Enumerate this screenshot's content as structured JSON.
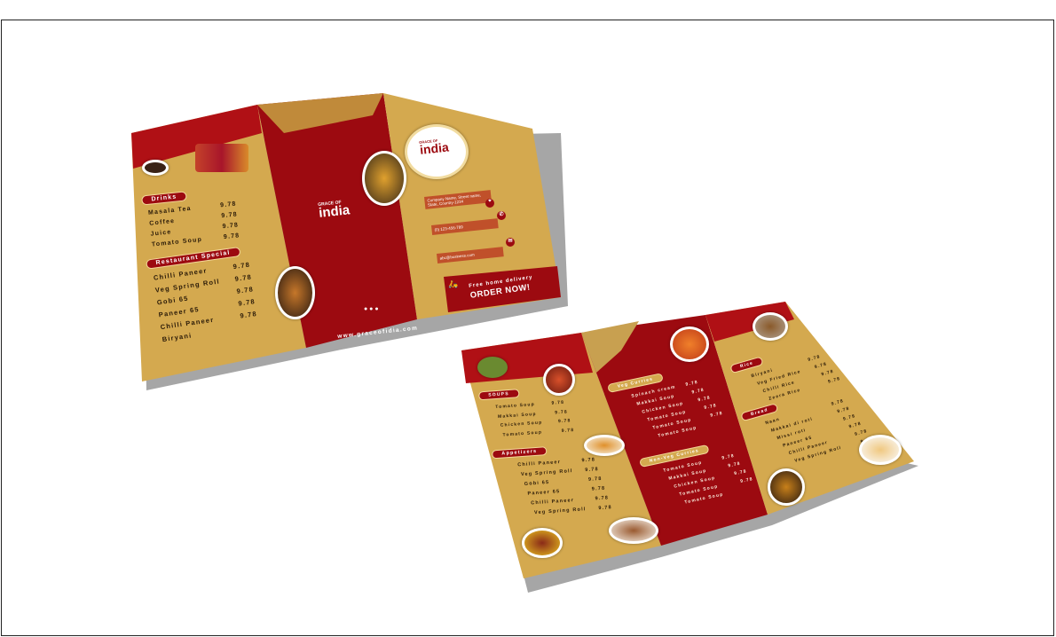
{
  "front": {
    "sections": [
      {
        "title": "Drinks",
        "items": [
          {
            "name": "Masala Tea",
            "price": "9.78"
          },
          {
            "name": "Coffee",
            "price": "9.78"
          },
          {
            "name": "Juice",
            "price": "9.78"
          },
          {
            "name": "Tomato Soup",
            "price": "9.78"
          }
        ]
      },
      {
        "title": "Restaurant Special",
        "items": [
          {
            "name": "Chilli Paneer",
            "price": "9.78"
          },
          {
            "name": "Veg Spring Roll",
            "price": "9.78"
          },
          {
            "name": "Gobi 65",
            "price": "9.78"
          },
          {
            "name": "Paneer 65",
            "price": "9.78"
          },
          {
            "name": "Chilli Paneer",
            "price": "9.78"
          },
          {
            "name": "Biryani",
            "price": ""
          }
        ]
      }
    ],
    "logo": {
      "small": "GRACE OF",
      "big": "india"
    },
    "website": "www.graceofidia.com",
    "contact": {
      "address": "Company Name, Street name, State, Country-1234",
      "phone": "(0) 123-456-789",
      "email": "abc@business.com"
    },
    "delivery": {
      "line1": "Free home delivery",
      "line2": "ORDER NOW!"
    }
  },
  "inside": {
    "soups": {
      "title": "SOUPS",
      "items": [
        {
          "name": "Tomato Soup",
          "price": "9.78"
        },
        {
          "name": "Makkai Soup",
          "price": "9.78"
        },
        {
          "name": "Chicken Soup",
          "price": "9.78"
        },
        {
          "name": "Tomato Soup",
          "price": "9.78"
        }
      ]
    },
    "appetizers": {
      "title": "Appetizers",
      "items": [
        {
          "name": "Chilli Paneer",
          "price": "9.78"
        },
        {
          "name": "Veg Spring Roll",
          "price": "9.78"
        },
        {
          "name": "Gobi 65",
          "price": "9.78"
        },
        {
          "name": "Paneer 65",
          "price": "9.78"
        },
        {
          "name": "Chilli Paneer",
          "price": "9.78"
        },
        {
          "name": "Veg Spring Roll",
          "price": "9.78"
        }
      ]
    },
    "veg": {
      "title": "Veg Curries",
      "items": [
        {
          "name": "Spinach cream",
          "price": "9.78"
        },
        {
          "name": "Makkai Soup",
          "price": "9.78"
        },
        {
          "name": "Chicken Soup",
          "price": "9.78"
        },
        {
          "name": "Tomato Soup",
          "price": "9.78"
        },
        {
          "name": "Tomato Soup",
          "price": "9.78"
        },
        {
          "name": "Tomato Soup",
          "price": ""
        }
      ]
    },
    "nonveg": {
      "title": "Non-Veg Curries",
      "items": [
        {
          "name": "Tomato Soup",
          "price": "9.78"
        },
        {
          "name": "Makkai Soup",
          "price": "9.78"
        },
        {
          "name": "Chicken Soup",
          "price": "9.78"
        },
        {
          "name": "Tomato Soup",
          "price": "9.78"
        },
        {
          "name": "Tomato Soup",
          "price": ""
        }
      ]
    },
    "rice": {
      "title": "Rice",
      "items": [
        {
          "name": "Biryani",
          "price": "9.78"
        },
        {
          "name": "Veg Fried Rice",
          "price": "9.78"
        },
        {
          "name": "Chilli Rice",
          "price": "9.78"
        },
        {
          "name": "Zeera Rice",
          "price": "9.78"
        }
      ]
    },
    "bread": {
      "title": "Bread",
      "items": [
        {
          "name": "Naan",
          "price": "9.78"
        },
        {
          "name": "Makkai di roti",
          "price": "9.78"
        },
        {
          "name": "Missi roti",
          "price": "9.78"
        },
        {
          "name": "Paneer 65",
          "price": "9.78"
        },
        {
          "name": "Chilli Paneer",
          "price": "9.78"
        },
        {
          "name": "Veg Spring Roll",
          "price": "9.78"
        }
      ]
    }
  }
}
